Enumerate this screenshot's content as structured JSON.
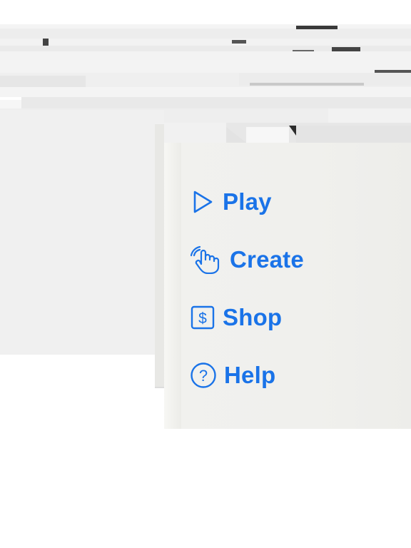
{
  "menu": {
    "items": [
      {
        "label": "Play",
        "icon": "play-icon"
      },
      {
        "label": "Create",
        "icon": "hand-tap-icon"
      },
      {
        "label": "Shop",
        "icon": "dollar-tag-icon"
      },
      {
        "label": "Help",
        "icon": "question-circle-icon"
      }
    ],
    "accent_color": "#1a73e8"
  }
}
